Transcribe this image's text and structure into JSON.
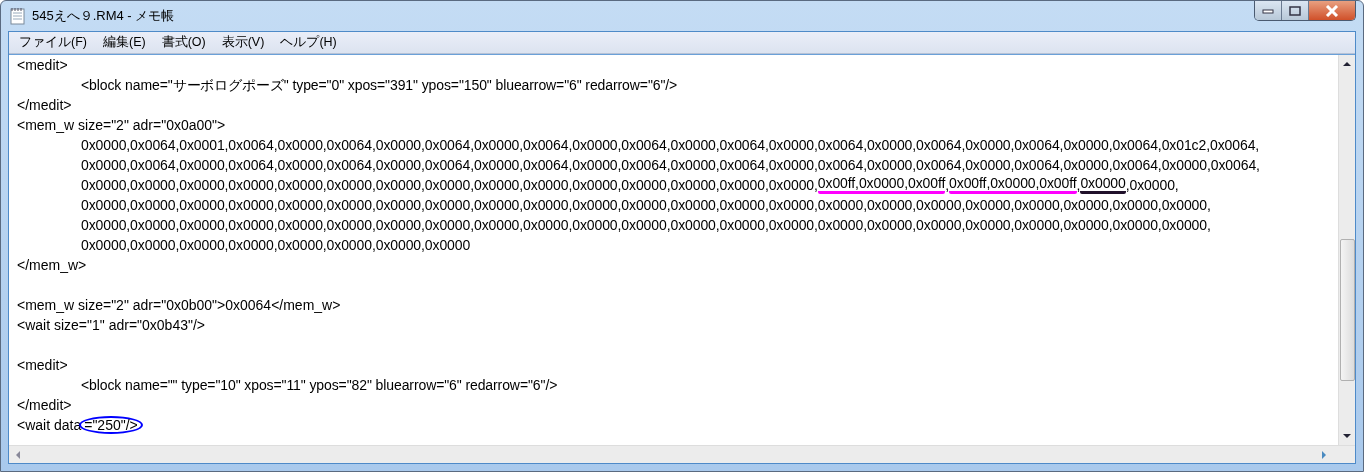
{
  "window": {
    "title": "545えへ９.RM4 - メモ帳"
  },
  "menu": [
    "ファイル(F)",
    "編集(E)",
    "書式(O)",
    "表示(V)",
    "ヘルプ(H)"
  ],
  "lines": [
    {
      "kind": "text",
      "indented": false,
      "segments": [
        {
          "kind": "plain",
          "text": "<medit>"
        }
      ]
    },
    {
      "kind": "text",
      "indented": true,
      "segments": [
        {
          "kind": "plain",
          "text": "<block name=\"サーボログポーズ\" type=\"0\" xpos=\"391\" ypos=\"150\" bluearrow=\"6\" redarrow=\"6\"/>"
        }
      ]
    },
    {
      "kind": "text",
      "indented": false,
      "segments": [
        {
          "kind": "plain",
          "text": "</medit>"
        }
      ]
    },
    {
      "kind": "text",
      "indented": false,
      "segments": [
        {
          "kind": "plain",
          "text": "<mem_w size=\"2\" adr=\"0x0a00\">"
        }
      ]
    },
    {
      "kind": "text",
      "indented": true,
      "segments": [
        {
          "kind": "plain",
          "text": "0x0000,0x0064,0x0001,0x0064,0x0000,0x0064,0x0000,0x0064,0x0000,0x0064,0x0000,0x0064,0x0000,0x0064,0x0000,0x0064,0x0000,0x0064,0x0000,0x0064,0x0000,0x0064,0x01c2,0x0064,"
        }
      ]
    },
    {
      "kind": "text",
      "indented": true,
      "segments": [
        {
          "kind": "plain",
          "text": "0x0000,0x0064,0x0000,0x0064,0x0000,0x0064,0x0000,0x0064,0x0000,0x0064,0x0000,0x0064,0x0000,0x0064,0x0000,0x0064,0x0000,0x0064,0x0000,0x0064,0x0000,0x0064,0x0000,0x0064,"
        }
      ]
    },
    {
      "kind": "text",
      "indented": true,
      "segments": [
        {
          "kind": "plain",
          "text": "0x0000,0x0000,0x0000,0x0000,0x0000,0x0000,0x0000,0x0000,0x0000,0x0000,0x0000,0x0000,0x0000,0x0000,0x0000,"
        },
        {
          "kind": "underlined",
          "color": "#ff00ff",
          "text": "0x00ff,0x0000,0x00ff"
        },
        {
          "kind": "plain",
          "text": ","
        },
        {
          "kind": "underlined",
          "color": "#ff00ff",
          "text": "0x00ff,0x0000,0x00ff"
        },
        {
          "kind": "plain",
          "text": ","
        },
        {
          "kind": "underlined",
          "color": "#20102a",
          "text": "0x0000"
        },
        {
          "kind": "plain",
          "text": ",0x0000,"
        }
      ]
    },
    {
      "kind": "text",
      "indented": true,
      "segments": [
        {
          "kind": "plain",
          "text": "0x0000,0x0000,0x0000,0x0000,0x0000,0x0000,0x0000,0x0000,0x0000,0x0000,0x0000,0x0000,0x0000,0x0000,0x0000,0x0000,0x0000,0x0000,0x0000,0x0000,0x0000,0x0000,0x0000,"
        }
      ]
    },
    {
      "kind": "text",
      "indented": true,
      "segments": [
        {
          "kind": "plain",
          "text": "0x0000,0x0000,0x0000,0x0000,0x0000,0x0000,0x0000,0x0000,0x0000,0x0000,0x0000,0x0000,0x0000,0x0000,0x0000,0x0000,0x0000,0x0000,0x0000,0x0000,0x0000,0x0000,0x0000,"
        }
      ]
    },
    {
      "kind": "text",
      "indented": true,
      "segments": [
        {
          "kind": "plain",
          "text": "0x0000,0x0000,0x0000,0x0000,0x0000,0x0000,0x0000,0x0000"
        }
      ]
    },
    {
      "kind": "text",
      "indented": false,
      "segments": [
        {
          "kind": "plain",
          "text": "</mem_w>"
        }
      ]
    },
    {
      "kind": "blank"
    },
    {
      "kind": "text",
      "indented": false,
      "segments": [
        {
          "kind": "plain",
          "text": "<mem_w size=\"2\" adr=\"0x0b00\">0x0064</mem_w>"
        }
      ]
    },
    {
      "kind": "text",
      "indented": false,
      "segments": [
        {
          "kind": "plain",
          "text": "<wait size=\"1\" adr=\"0x0b43\"/>"
        }
      ]
    },
    {
      "kind": "blank"
    },
    {
      "kind": "text",
      "indented": false,
      "segments": [
        {
          "kind": "plain",
          "text": "<medit>"
        }
      ]
    },
    {
      "kind": "text",
      "indented": true,
      "segments": [
        {
          "kind": "plain",
          "text": "<block name=\"\" type=\"10\" xpos=\"11\" ypos=\"82\" bluearrow=\"6\" redarrow=\"6\"/>"
        }
      ]
    },
    {
      "kind": "text",
      "indented": false,
      "segments": [
        {
          "kind": "plain",
          "text": "</medit>"
        }
      ]
    },
    {
      "kind": "text",
      "indented": false,
      "segments": [
        {
          "kind": "plain",
          "text": "<wait data"
        },
        {
          "kind": "circled",
          "color": "#0000ff",
          "text": "=\"250\"/>"
        }
      ]
    }
  ]
}
